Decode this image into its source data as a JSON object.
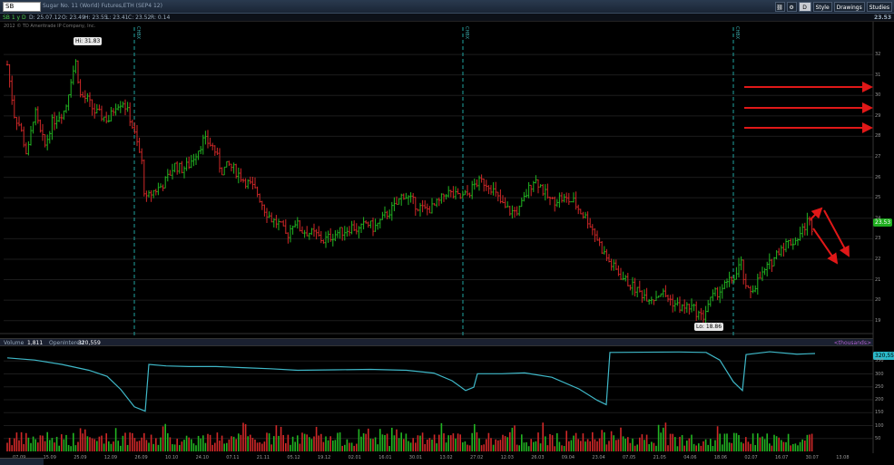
{
  "header": {
    "symbol": "SB",
    "title": "Sugar No. 11 (World) Futures,ETH (SEP4 12)",
    "buttons": [
      "Style",
      "Drawings",
      "Studies"
    ],
    "d_label": "D"
  },
  "quote": {
    "tag": "SB 1 y D",
    "open_date": "D: 25.07.12",
    "o": "O: 23.49",
    "h": "H: 23.55",
    "l": "L: 23.41",
    "c": "C: 23.52",
    "r": "R: 0.14",
    "last": "23.53"
  },
  "copyright": "2012 © TD Ameritrade IP Company, Inc.",
  "hi_label": "Hi: 31.83",
  "lo_label": "Lo: 18.86",
  "last_badge": "23.53",
  "event_labels": [
    "CHBX",
    "CHBX",
    "CHBX"
  ],
  "volume_header": {
    "volume": "Volume",
    "vol_value": "1,811",
    "oi": "OpenInterest",
    "oi_value": "320,559",
    "thousands": "<thousands>"
  },
  "oi_badge": "320,559",
  "colors": {
    "up": "#22b422",
    "down": "#d02828",
    "oi": "#3fb8c8",
    "arrows": "#e01818",
    "event_lines": "#1fa3a0",
    "background": "#000000"
  },
  "chart_data": {
    "type": "bar",
    "price_axis": {
      "ylim": [
        18.5,
        32.8
      ],
      "ticks": [
        32,
        31,
        30,
        29,
        28,
        27,
        26,
        25,
        24,
        23,
        22,
        21,
        20,
        19
      ]
    },
    "volume_axis": {
      "ticks": [
        350,
        300,
        250,
        200,
        150,
        100,
        50
      ]
    },
    "x_ticks": [
      "07.09",
      "15.09",
      "25.09",
      "12.09",
      "26.09",
      "10.10",
      "24.10",
      "07.11",
      "21.11",
      "05.12",
      "19.12",
      "02.01",
      "16.01",
      "30.01",
      "13.02",
      "27.02",
      "12.03",
      "26.03",
      "09.04",
      "23.04",
      "07.05",
      "21.05",
      "04.06",
      "18.06",
      "02.07",
      "16.07",
      "30.07",
      "13.08"
    ],
    "price_path": [
      [
        0,
        31.5
      ],
      [
        8,
        29
      ],
      [
        14,
        28.5
      ],
      [
        22,
        27
      ],
      [
        30,
        29.3
      ],
      [
        36,
        28.2
      ],
      [
        42,
        27.5
      ],
      [
        48,
        28.6
      ],
      [
        56,
        29
      ],
      [
        64,
        29.3
      ],
      [
        70,
        30.8
      ],
      [
        76,
        31.7
      ],
      [
        80,
        30
      ],
      [
        88,
        29.8
      ],
      [
        96,
        29.2
      ],
      [
        104,
        29
      ],
      [
        112,
        28.8
      ],
      [
        120,
        29.6
      ],
      [
        128,
        29.7
      ],
      [
        136,
        28.8
      ],
      [
        142,
        27.8
      ],
      [
        148,
        26.8
      ],
      [
        152,
        24.8
      ],
      [
        160,
        25.3
      ],
      [
        168,
        25.5
      ],
      [
        176,
        25.9
      ],
      [
        184,
        26.6
      ],
      [
        192,
        26.4
      ],
      [
        200,
        26.6
      ],
      [
        208,
        27.2
      ],
      [
        216,
        27.8
      ],
      [
        222,
        27.7
      ],
      [
        228,
        27.4
      ],
      [
        236,
        26.3
      ],
      [
        244,
        26.6
      ],
      [
        252,
        26.3
      ],
      [
        260,
        25.9
      ],
      [
        268,
        25.6
      ],
      [
        276,
        25.2
      ],
      [
        284,
        24.4
      ],
      [
        292,
        23.9
      ],
      [
        300,
        23.7
      ],
      [
        308,
        23.1
      ],
      [
        316,
        23.9
      ],
      [
        324,
        23.4
      ],
      [
        332,
        23.3
      ],
      [
        340,
        23.2
      ],
      [
        348,
        22.9
      ],
      [
        356,
        23.1
      ],
      [
        364,
        23.3
      ],
      [
        372,
        23.4
      ],
      [
        380,
        23.6
      ],
      [
        388,
        23.4
      ],
      [
        396,
        23.8
      ],
      [
        404,
        23.5
      ],
      [
        412,
        23.9
      ],
      [
        420,
        24.3
      ],
      [
        428,
        24.6
      ],
      [
        436,
        25.2
      ],
      [
        444,
        24.9
      ],
      [
        452,
        24.6
      ],
      [
        460,
        24.4
      ],
      [
        468,
        24.5
      ],
      [
        476,
        24.8
      ],
      [
        484,
        25.3
      ],
      [
        492,
        25.1
      ],
      [
        500,
        25
      ],
      [
        508,
        25.2
      ],
      [
        516,
        25.7
      ],
      [
        524,
        25.8
      ],
      [
        532,
        25.6
      ],
      [
        540,
        25
      ],
      [
        548,
        24.5
      ],
      [
        556,
        24.3
      ],
      [
        564,
        24.4
      ],
      [
        572,
        25.2
      ],
      [
        580,
        25.9
      ],
      [
        586,
        25.7
      ],
      [
        592,
        25.2
      ],
      [
        600,
        24.8
      ],
      [
        608,
        25
      ],
      [
        616,
        24.9
      ],
      [
        624,
        24.8
      ],
      [
        632,
        24.3
      ],
      [
        640,
        23.9
      ],
      [
        648,
        23.2
      ],
      [
        656,
        22.4
      ],
      [
        664,
        21.8
      ],
      [
        672,
        21.4
      ],
      [
        680,
        21
      ],
      [
        688,
        20.7
      ],
      [
        696,
        20.4
      ],
      [
        704,
        20.2
      ],
      [
        712,
        20.1
      ],
      [
        720,
        20.4
      ],
      [
        728,
        20.1
      ],
      [
        736,
        19.8
      ],
      [
        744,
        19.6
      ],
      [
        752,
        19.7
      ],
      [
        760,
        19.4
      ],
      [
        766,
        19.1
      ],
      [
        772,
        19.8
      ],
      [
        780,
        20.3
      ],
      [
        788,
        20.6
      ],
      [
        796,
        20.9
      ],
      [
        804,
        21.3
      ],
      [
        808,
        21.9
      ],
      [
        814,
        20.4
      ],
      [
        820,
        20.5
      ],
      [
        828,
        21
      ],
      [
        836,
        21.5
      ],
      [
        844,
        22
      ],
      [
        852,
        22.6
      ],
      [
        860,
        22.8
      ],
      [
        868,
        22.9
      ],
      [
        876,
        23.4
      ],
      [
        882,
        23.9
      ],
      [
        888,
        23.5
      ]
    ],
    "oi_path": [
      [
        0,
        355
      ],
      [
        30,
        345
      ],
      [
        60,
        325
      ],
      [
        90,
        298
      ],
      [
        110,
        270
      ],
      [
        125,
        210
      ],
      [
        140,
        130
      ],
      [
        152,
        110
      ],
      [
        156,
        325
      ],
      [
        175,
        318
      ],
      [
        200,
        315
      ],
      [
        230,
        315
      ],
      [
        260,
        310
      ],
      [
        290,
        305
      ],
      [
        320,
        298
      ],
      [
        360,
        300
      ],
      [
        400,
        302
      ],
      [
        440,
        298
      ],
      [
        470,
        285
      ],
      [
        490,
        250
      ],
      [
        505,
        205
      ],
      [
        514,
        220
      ],
      [
        518,
        282
      ],
      [
        545,
        282
      ],
      [
        570,
        286
      ],
      [
        600,
        266
      ],
      [
        630,
        212
      ],
      [
        650,
        160
      ],
      [
        660,
        140
      ],
      [
        664,
        380
      ],
      [
        700,
        381
      ],
      [
        740,
        382
      ],
      [
        770,
        380
      ],
      [
        785,
        345
      ],
      [
        800,
        245
      ],
      [
        810,
        205
      ],
      [
        814,
        370
      ],
      [
        840,
        383
      ],
      [
        870,
        372
      ],
      [
        890,
        375
      ]
    ],
    "event_x": [
      148,
      510,
      808
    ],
    "arrows": [
      [
        820,
        96,
        960,
        96
      ],
      [
        820,
        119,
        960,
        119
      ],
      [
        820,
        141,
        960,
        141
      ],
      [
        893,
        242,
        905,
        230
      ],
      [
        908,
        232,
        935,
        282
      ],
      [
        896,
        252,
        922,
        290
      ]
    ]
  }
}
